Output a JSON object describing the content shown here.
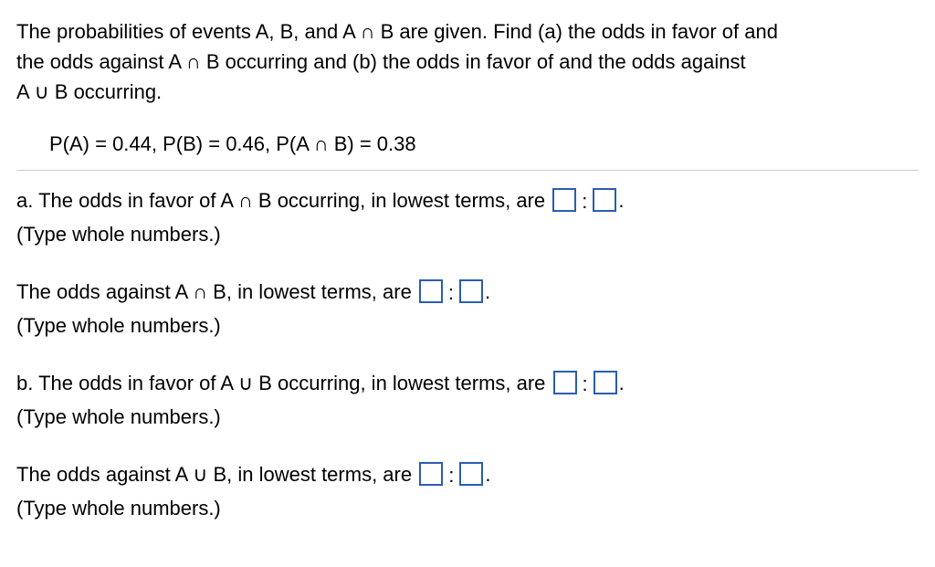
{
  "problem": {
    "line1": "The probabilities of events A, B, and A ∩ B are given. Find (a) the odds in favor of and",
    "line2": "the odds against A ∩ B occurring and (b) the odds in favor of and the odds against",
    "line3": "A ∪ B occurring."
  },
  "given": "P(A) = 0.44, P(B) = 0.46, P(A ∩ B) = 0.38",
  "parts": {
    "a1": {
      "text": "a. The odds in favor of A ∩ B occurring, in lowest terms, are ",
      "after": ".",
      "hint": "(Type whole numbers.)"
    },
    "a2": {
      "text": "The odds against A ∩ B, in lowest terms, are ",
      "after": ".",
      "hint": "(Type whole numbers.)"
    },
    "b1": {
      "text": "b. The odds in favor of A ∪ B occurring, in lowest terms, are ",
      "after": ".",
      "hint": "(Type whole numbers.)"
    },
    "b2": {
      "text": "The odds against A ∪ B, in lowest terms, are ",
      "after": ".",
      "hint": "(Type whole numbers.)"
    }
  },
  "colon": ":"
}
